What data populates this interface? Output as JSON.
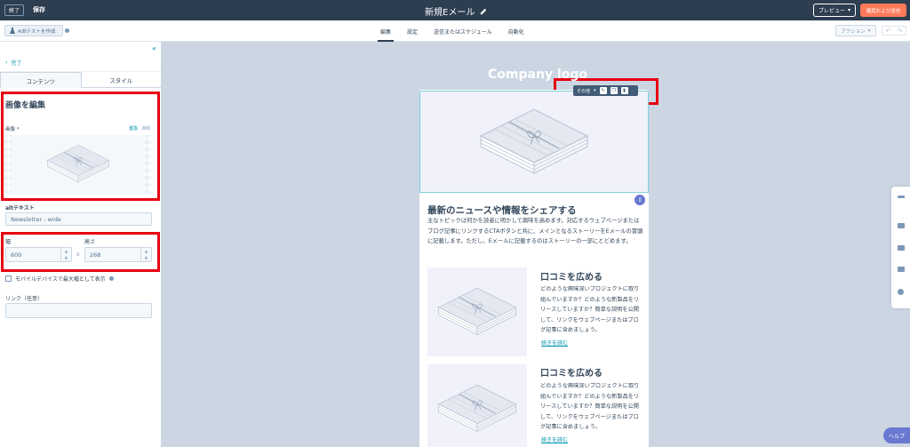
{
  "topbar": {
    "exit_label": "終了",
    "save_label": "保存",
    "title": "新規Eメール",
    "preview_label": "プレビュー",
    "review_label": "確認および送信"
  },
  "subbar": {
    "ab_test_label": "A/Bテストを作成",
    "tabs": [
      "編集",
      "設定",
      "送信またはスケジュール",
      "自動化"
    ],
    "actions_label": "アクション"
  },
  "left_panel": {
    "back_label": "完了",
    "tabs": [
      "コンテンツ",
      "スタイル"
    ],
    "section_title": "画像を編集",
    "image_label": "画像 *",
    "image_action": "置換",
    "alt_label": "altテキスト",
    "alt_value": "Newsletter - wide",
    "width_label": "幅",
    "width_value": "600",
    "height_label": "高さ",
    "height_value": "268",
    "x_separator": "x",
    "mobile_label": "モバイルデバイスで最大幅として表示",
    "link_label": "リンク（任意）",
    "link_value": ""
  },
  "canvas": {
    "company_logo": "Company logo",
    "toolbar_label": "その他",
    "news_title": "最新のニュースや情報をシェアする",
    "news_body": "主なトピックは何かを読者に明かして興味を高めます。対応するウェブページまたはブログ記事にリンクするCTAボタンと共に、メインとなるストーリーをEメールの冒頭に記載します。ただし、Eメールに記載するのはストーリーの一部にとどめます。",
    "articles": [
      {
        "title": "口コミを広める",
        "body": "どのような興味深いプロジェクトに取り組んでいますか？どのような新製品をリリースしていますか？簡単な説明を公開して、リンクをウェブページまたはブログ記事に含めましょう。",
        "read_more": "続きを読む"
      },
      {
        "title": "口コミを広める",
        "body": "どのような興味深いプロジェクトに取り組んでいますか？どのような新製品をリリースしていますか？簡単な説明を公開して、リンクをウェブページまたはブログ記事に含めましょう。",
        "read_more": "続きを読む"
      }
    ],
    "info_badge": "i"
  },
  "help_label": "ヘルプ",
  "colors": {
    "topbar": "#2d3e50",
    "accent": "#ff7a59",
    "link": "#0091ae",
    "highlight": "#e60012",
    "canvas_bg": "#cbd6e2"
  },
  "icons": [
    "pencil-icon",
    "flask-icon",
    "info-icon",
    "chevron-left-icon",
    "chevron-down-icon",
    "trash-icon",
    "clone-icon",
    "undo-icon",
    "redo-icon",
    "chat-icon",
    "calendar-icon",
    "help-icon"
  ]
}
